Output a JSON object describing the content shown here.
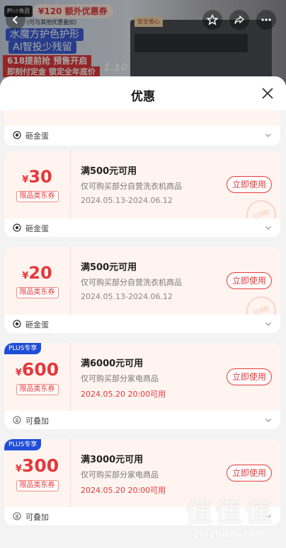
{
  "background": {
    "plus_tag": "Plus会员",
    "promo_amount": "¥120 额外优惠券",
    "promo_sub": "(可与其他优惠叠加)",
    "slogan_line1": "水魔方护色护形",
    "slogan_line2": "AI智投少残留",
    "slogan_line3": "618提前抢 预售开启",
    "slogan_line4": "即刻付定金 锁定全年底价",
    "zoom_label": "1.10",
    "washer_label": "安全省心"
  },
  "sheet": {
    "title": "优惠"
  },
  "coupons": [
    {
      "currency": "¥",
      "amount": "30",
      "category": "限品类东券",
      "condition": "满500元可用",
      "scope": "仅可购买部分自营洗衣机商品",
      "validity": "2024.05.13-2024.06.12",
      "validity_hot": false,
      "button": "立即使用",
      "stamp": "已领取",
      "footer": "砸金蛋",
      "footer_icon": "egg-icon"
    },
    {
      "currency": "¥",
      "amount": "20",
      "category": "限品类东券",
      "condition": "满500元可用",
      "scope": "仅可购买部分自营洗衣机商品",
      "validity": "2024.05.13-2024.06.12",
      "validity_hot": false,
      "button": "立即使用",
      "stamp": "已领取",
      "footer": "砸金蛋",
      "footer_icon": "egg-icon"
    },
    {
      "badge": "PLUS专享",
      "currency": "¥",
      "amount": "600",
      "category": "限品类东券",
      "condition": "满6000元可用",
      "scope": "仅可购买部分家电商品",
      "validity": "2024.05.20 20:00可用",
      "validity_hot": true,
      "button": "立即使用",
      "footer": "可叠加",
      "footer_icon": "stack-icon"
    },
    {
      "badge": "PLUS专享",
      "currency": "¥",
      "amount": "300",
      "category": "限品类东券",
      "condition": "满3000元可用",
      "scope": "仅可购买部分家电商品",
      "validity": "2024.05.20 20:00可用",
      "validity_hot": true,
      "button": "立即使用",
      "footer": "可叠加",
      "footer_icon": "stack-icon"
    }
  ],
  "partial_card": {
    "footer": "砸金蛋"
  },
  "watermark": {
    "glyphs": "值值值",
    "url": "zhizhizhi.com"
  },
  "colors": {
    "accent": "#e4393c",
    "plus_blue": "#1f4ed8",
    "coupon_bg": "#fff4ef"
  }
}
